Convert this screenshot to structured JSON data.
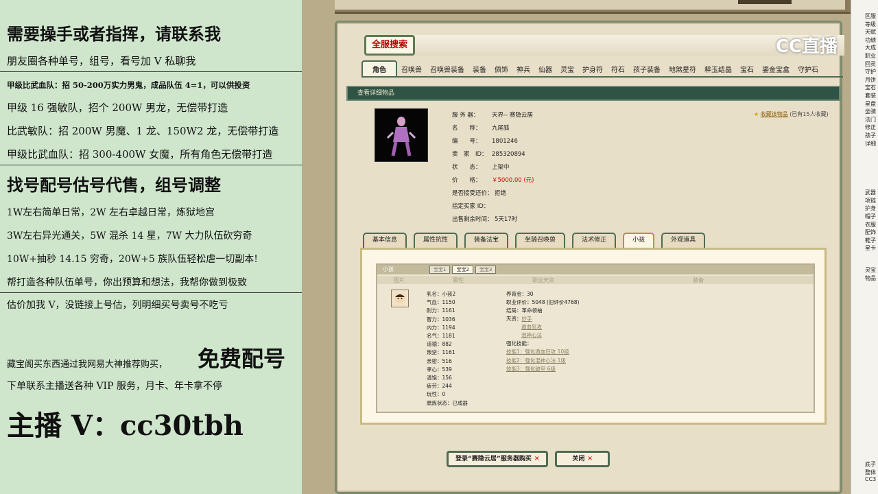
{
  "promo": {
    "l1": "需要操手或者指挥，请联系我",
    "l2": "朋友圈各种单号，组号，看号加 V 私聊我",
    "l3": "甲级比武血队：招 50-200万实力男鬼，成品队伍 4=1，可以供投资",
    "l4": "甲级 16 强敏队，招个 200W 男龙，无偿带打造",
    "l5": "比武敏队：招 200W 男魔、1 龙、150W2 龙，无偿带打造",
    "l6": "甲级比武血队：招 300-400W 女魔，所有角色无偿带打造",
    "l7": "找号配号估号代售，组号调整",
    "l8": "1W左右简单日常，2W 左右卓越日常，炼狱地宫",
    "l9": "3W左右异光通关，5W 混杀 14 星，7W 大力队伍砍穷奇",
    "l10": "10W+抽秒 14.15 穷奇，20W+5 族队伍轻松虐一切副本!",
    "l11": "帮打造各种队伍单号，你出预算和想法，我帮你做到极致",
    "l12": "估价加我 V，没链接上号估，列明细买号卖号不吃亏",
    "l13a": "藏宝阁买东西通过我网易大神推荐购买，",
    "l13b": "免费配号",
    "l14": "下单联系主播送各种 VIP 服务，月卡、年卡拿不停",
    "l15": "主播 V：cc30tbh"
  },
  "game": {
    "title": "全服搜索",
    "logo": "CC直播",
    "tabs": [
      "角色",
      "召唤兽",
      "召唤兽装备",
      "装备",
      "佩饰",
      "神兵",
      "仙器",
      "灵宝",
      "护身符",
      "符石",
      "孩子装备",
      "地煞星符",
      "粹玉结晶",
      "宝石",
      "鎏金宝盒",
      "守护石"
    ],
    "section": "查看详细物品",
    "info": {
      "server_k": "服 务 器：",
      "server_v": "天界-- 赛隐云居",
      "name_k": "名　　称：",
      "name_v": "九尾狐",
      "id_k": "编　　号：",
      "id_v": "1801246",
      "seller_k": "卖　家　ID：",
      "seller_v": "285320894",
      "status_k": "状　　态：",
      "status_v": "上架中",
      "price_k": "价　　格：",
      "price_v": "￥5000.00 (元)",
      "bargain_k": "是否接受还价：",
      "bargain_v": "拒绝",
      "buyer_k": "指定买家 ID：",
      "buyer_v": "",
      "remain_k": "出售剩余时间：",
      "remain_v": "5天17时"
    },
    "fav_link": "收藏该物品",
    "fav_note": "(已有15人收藏)",
    "subtabs": [
      "基本信息",
      "属性抗性",
      "装备法宝",
      "坐骑召唤兽",
      "法术修正",
      "小孩",
      "外观道具"
    ],
    "kid": {
      "header": "小孩",
      "kidtabs": [
        "宝宝1",
        "宝宝2",
        "宝宝3"
      ],
      "cols": [
        "图片",
        "属性",
        "职业天资",
        "装备"
      ],
      "stats": [
        "乳名：小孩2",
        "气血：1150",
        "耐力：1161",
        "智力：1036",
        "内力：1194",
        "名气：1181",
        "道德：882",
        "叛逆：1161",
        "亲密：516",
        "孝心：539",
        "温饱：156",
        "疲劳：244",
        "玩性：0",
        "磨炼状态：已成器"
      ],
      "info1": "养育金：30",
      "info2": "职业评价：5048 (旧评价4768)",
      "info3": "结局：革命领袖",
      "info4": "天资：",
      "info4v": "妙手",
      "info5": "遁血狂攻",
      "info6": "混神心法",
      "info7": "强化技能：",
      "info8": "技能1：强化遁血狂攻 10级",
      "info9": "技能2：强化混神心法 1级",
      "info10": "技能3：强化破甲 6级"
    },
    "btn_login": "登录“赛隐云居”服务器购买",
    "btn_close": "关闭"
  },
  "right": {
    "items": [
      "区服",
      "等级",
      "天赋",
      "功绩",
      "大成",
      "职业",
      "回灵",
      "守护",
      "月饼",
      "宝石",
      "套装",
      "星盘",
      "坐骑",
      "法门",
      "修正",
      "孩子",
      "详细",
      "武器",
      "项链",
      "护身",
      "帽子",
      "衣服",
      "配饰",
      "鞋子",
      "星卡",
      "灵宝",
      "物品",
      "底子",
      "整体",
      "CC3"
    ]
  }
}
